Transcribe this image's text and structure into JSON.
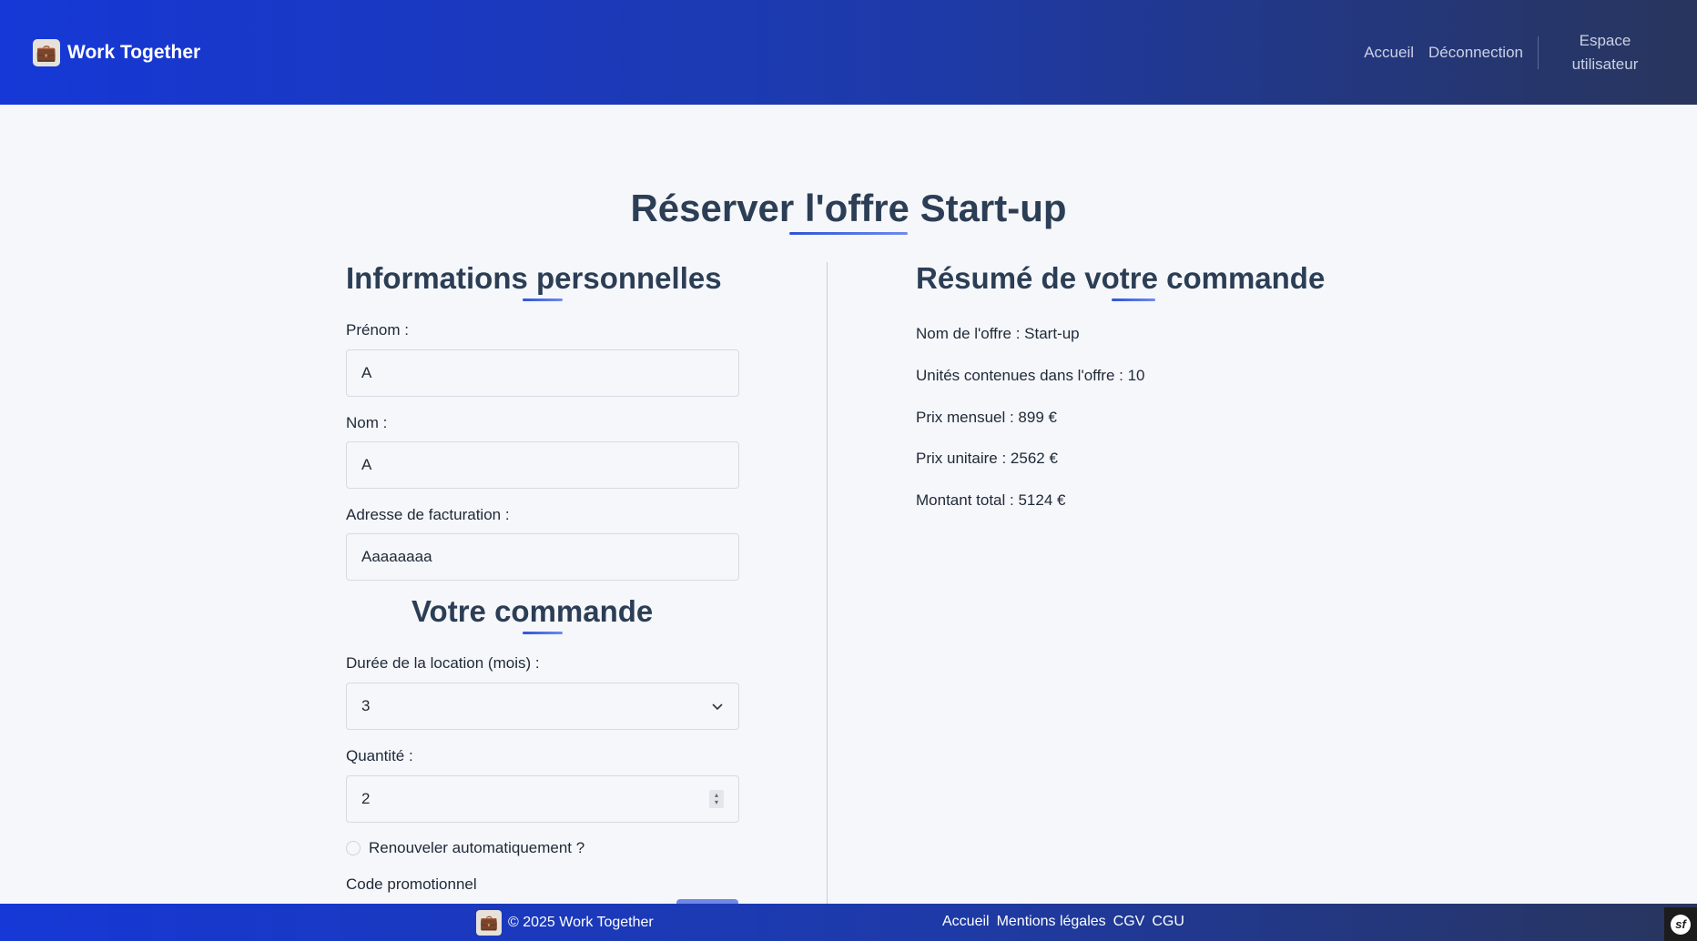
{
  "header": {
    "logo_icon": "app-logo-icon",
    "brand": "Work Together",
    "nav": {
      "home": "Accueil",
      "logout": "Déconnection",
      "user_space": "Espace utilisateur"
    }
  },
  "main": {
    "title": "Réserver l'offre Start-up"
  },
  "personal": {
    "title": "Informations personnelles",
    "firstname_label": "Prénom :",
    "firstname_value": "A",
    "lastname_label": "Nom :",
    "lastname_value": "A",
    "address_label": "Adresse de facturation :",
    "address_value": "Aaaaaaaa"
  },
  "order": {
    "title": "Votre commande",
    "duration_label": "Durée de la location (mois) :",
    "duration_value": "3",
    "quantity_label": "Quantité :",
    "quantity_value": "2",
    "auto_renew_label": "Renouveler automatiquement ?",
    "promo_label": "Code promotionnel"
  },
  "summary": {
    "title": "Résumé de votre commande",
    "offer_name": "Nom de l'offre : Start-up",
    "units": "Unités contenues dans l'offre : 10",
    "monthly_price": "Prix mensuel : 899 €",
    "unit_price": "Prix unitaire : 2562 €",
    "total": "Montant total : 5124 €"
  },
  "footer": {
    "copyright": "© 2025 Work Together",
    "links": {
      "home": "Accueil",
      "legal": "Mentions légales",
      "cgv": "CGV",
      "cgu": "CGU"
    }
  },
  "colors": {
    "header_start": "#1638d6",
    "header_end": "#28355c",
    "accent_underline": "#2f54d6",
    "heading": "#2c3e55",
    "background": "#f5f7fb"
  }
}
